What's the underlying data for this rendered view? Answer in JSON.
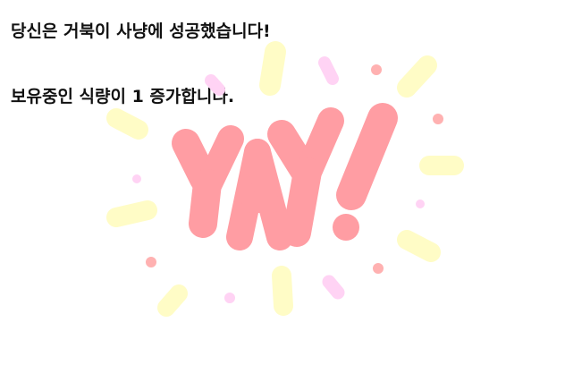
{
  "messages": {
    "line1": "당신은 거북이 사냥에 성공했습니다!",
    "line2": "보유중인 식량이 1 증가합니다."
  },
  "celebration": {
    "word": "YAY!",
    "icon": "yay-burst-illustration",
    "colors": {
      "letters": "#ff9da3",
      "rays_yellow": "#fffcc6",
      "dots_pink": "#ffd3f4",
      "dots_red": "#ffb1b1"
    }
  }
}
